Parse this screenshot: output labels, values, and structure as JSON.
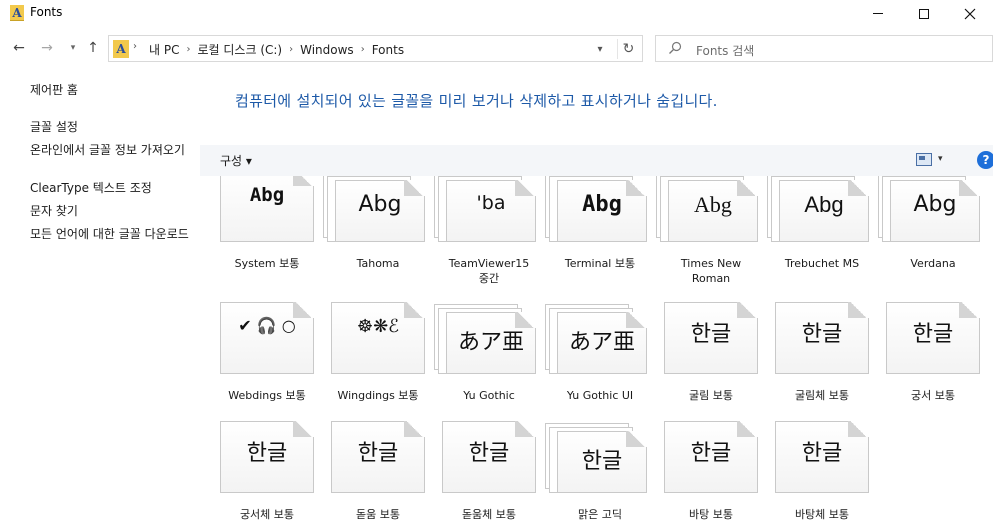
{
  "window": {
    "title": "Fonts",
    "app_icon_letter": "A"
  },
  "nav": {
    "back_glyph": "←",
    "forward_glyph": "→",
    "recent_glyph": "▾",
    "up_glyph": "↑",
    "breadcrumbs": [
      "내 PC",
      "로컬 디스크 (C:)",
      "Windows",
      "Fonts"
    ],
    "dropdown_glyph": "▾",
    "refresh_glyph": "↻",
    "search_placeholder": "Fonts 검색"
  },
  "left_pane": {
    "home": "제어판 홈",
    "links": [
      "글꼴 설정",
      "온라인에서 글꼴 정보 가져오기",
      "ClearType 텍스트 조정",
      "문자 찾기",
      "모든 언어에 대한 글꼴 다운로드"
    ]
  },
  "content": {
    "heading": "컴퓨터에 설치되어 있는 글꼴을 미리 보거나 삭제하고 표시하거나 숨깁니다.",
    "organize": "구성 ▾",
    "view_drop": "▾",
    "help": "?"
  },
  "fonts": [
    {
      "sample": "Abg",
      "label": "System 보통",
      "stack": false
    },
    {
      "sample": "Abg",
      "label": "Tahoma",
      "stack": true
    },
    {
      "sample": "'ba",
      "label": "TeamViewer15 중간",
      "stack": true
    },
    {
      "sample": "Abg",
      "label": "Terminal 보통",
      "stack": true
    },
    {
      "sample": "Abg",
      "label": "Times New Roman",
      "stack": true
    },
    {
      "sample": "Abg",
      "label": "Trebuchet MS",
      "stack": true
    },
    {
      "sample": "Abg",
      "label": "Verdana",
      "stack": true
    },
    {
      "sample": "✔ 🎧 ○",
      "label": "Webdings 보통",
      "stack": false
    },
    {
      "sample": "☸❋ℰ",
      "label": "Wingdings 보통",
      "stack": false
    },
    {
      "sample": "あア亜",
      "label": "Yu Gothic",
      "stack": true
    },
    {
      "sample": "あア亜",
      "label": "Yu Gothic UI",
      "stack": true
    },
    {
      "sample": "한글",
      "label": "굴림 보통",
      "stack": false
    },
    {
      "sample": "한글",
      "label": "굴림체 보통",
      "stack": false
    },
    {
      "sample": "한글",
      "label": "궁서 보통",
      "stack": false
    },
    {
      "sample": "한글",
      "label": "궁서체 보통",
      "stack": false
    },
    {
      "sample": "한글",
      "label": "돋움 보통",
      "stack": false
    },
    {
      "sample": "한글",
      "label": "돋움체 보통",
      "stack": false
    },
    {
      "sample": "한글",
      "label": "맑은 고딕",
      "stack": true
    },
    {
      "sample": "한글",
      "label": "바탕 보통",
      "stack": false
    },
    {
      "sample": "한글",
      "label": "바탕체 보통",
      "stack": false
    }
  ]
}
